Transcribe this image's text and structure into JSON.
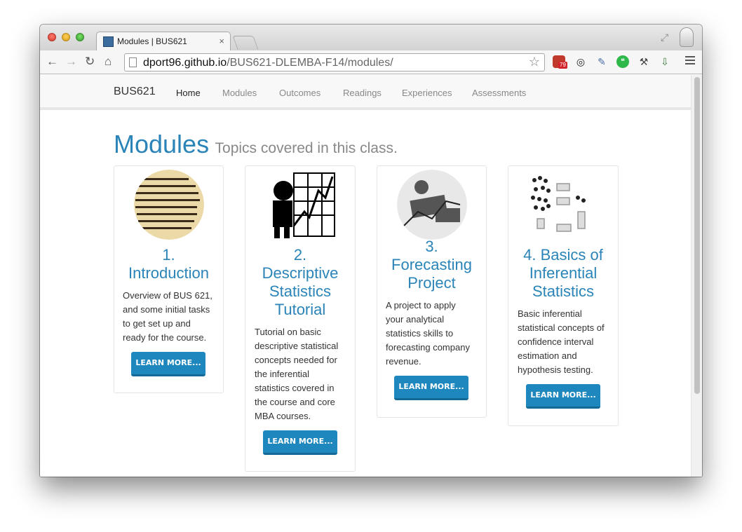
{
  "browser": {
    "tab_title": "Modules | BUS621",
    "tab_close": "×",
    "url_host": "dport96.github.io",
    "url_path": "/BUS621-DLEMBA-F14/modules/",
    "back_glyph": "←",
    "forward_glyph": "→",
    "reload_glyph": "↻",
    "home_glyph": "⌂",
    "star_glyph": "☆",
    "extension_badge": "79"
  },
  "navbar": {
    "brand": "BUS621",
    "links": [
      "Home",
      "Modules",
      "Outcomes",
      "Readings",
      "Experiences",
      "Assessments"
    ],
    "active": "Home"
  },
  "page": {
    "title": "Modules",
    "subtitle": "Topics covered in this class."
  },
  "modules": [
    {
      "title_lines": [
        "1.",
        "Introduction"
      ],
      "text_lines": [
        "Overview of BUS 621,",
        "and some initial tasks",
        "to get set up and",
        "ready for the course."
      ],
      "button": "LEARN MORE...",
      "image": "dictionary-definition-thumbnail"
    },
    {
      "title_lines": [
        "2.",
        "Descriptive",
        "Statistics",
        "Tutorial"
      ],
      "text_lines": [
        "Tutorial on basic",
        "descriptive statistical",
        "concepts needed for",
        "the inferential",
        "statistics covered in",
        "the course and core",
        "MBA courses."
      ],
      "button": "LEARN MORE...",
      "image": "businessman-chart-thumbnail"
    },
    {
      "title_lines": [
        "3.",
        "Forecasting",
        "Project"
      ],
      "text_lines": [
        "A project to apply",
        "your analytical",
        "statistics skills to",
        "forecasting company",
        "revenue."
      ],
      "button": "LEARN MORE...",
      "image": "forecasting-illustration-thumbnail"
    },
    {
      "title_lines": [
        "4. Basics of",
        "Inferential",
        "Statistics"
      ],
      "text_lines": [
        "Basic inferential",
        "statistical concepts of",
        "confidence interval",
        "estimation and",
        "hypothesis testing."
      ],
      "button": "LEARN MORE...",
      "image": "population-sample-thumbnail"
    }
  ],
  "colors": {
    "accent": "#2a84b8",
    "button": "#1d87be"
  }
}
